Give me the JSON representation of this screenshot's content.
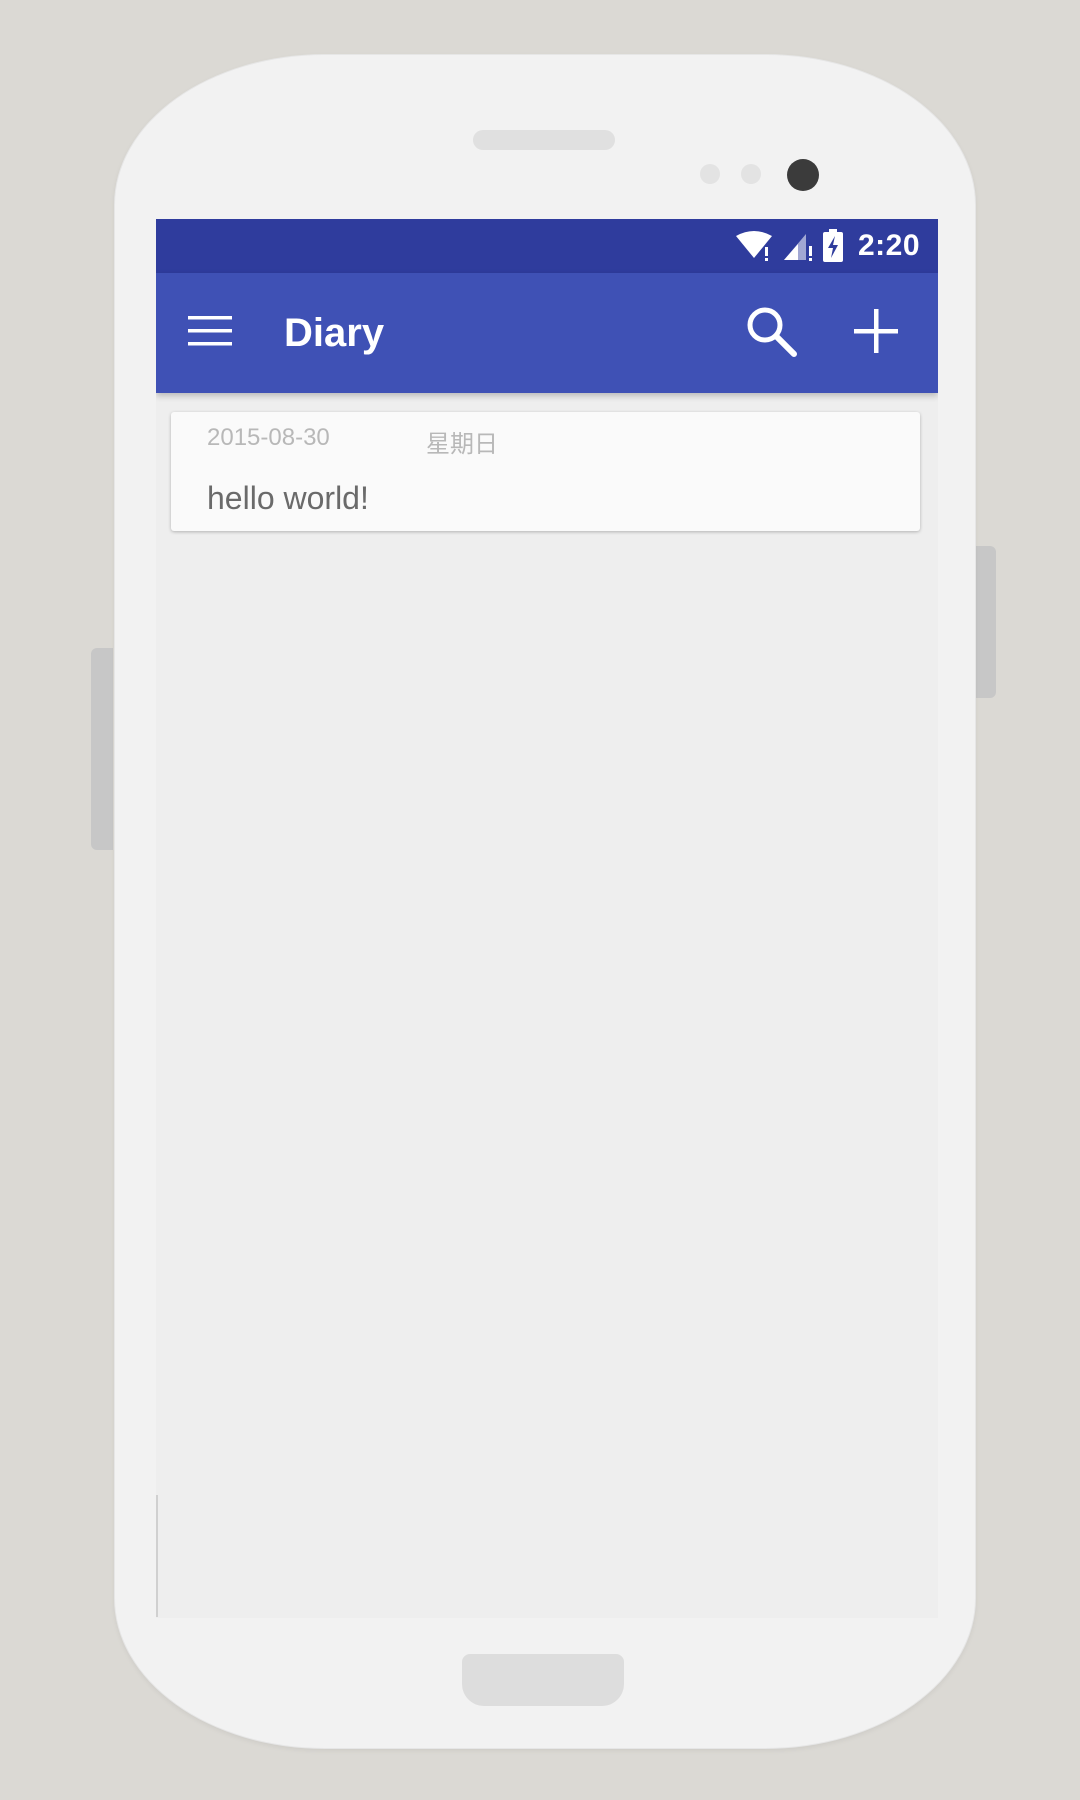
{
  "status_bar": {
    "time": "2:20",
    "icons": [
      "wifi-icon",
      "cell-signal-icon",
      "battery-charging-icon"
    ],
    "color": "#2f3c9d"
  },
  "app_bar": {
    "title": "Diary",
    "menu_icon": "hamburger-menu-icon",
    "search_icon": "search-icon",
    "add_icon": "add-icon",
    "color": "#3f51b5"
  },
  "entries": [
    {
      "date": "2015-08-30",
      "weekday": "星期日",
      "text": "hello world!"
    }
  ]
}
